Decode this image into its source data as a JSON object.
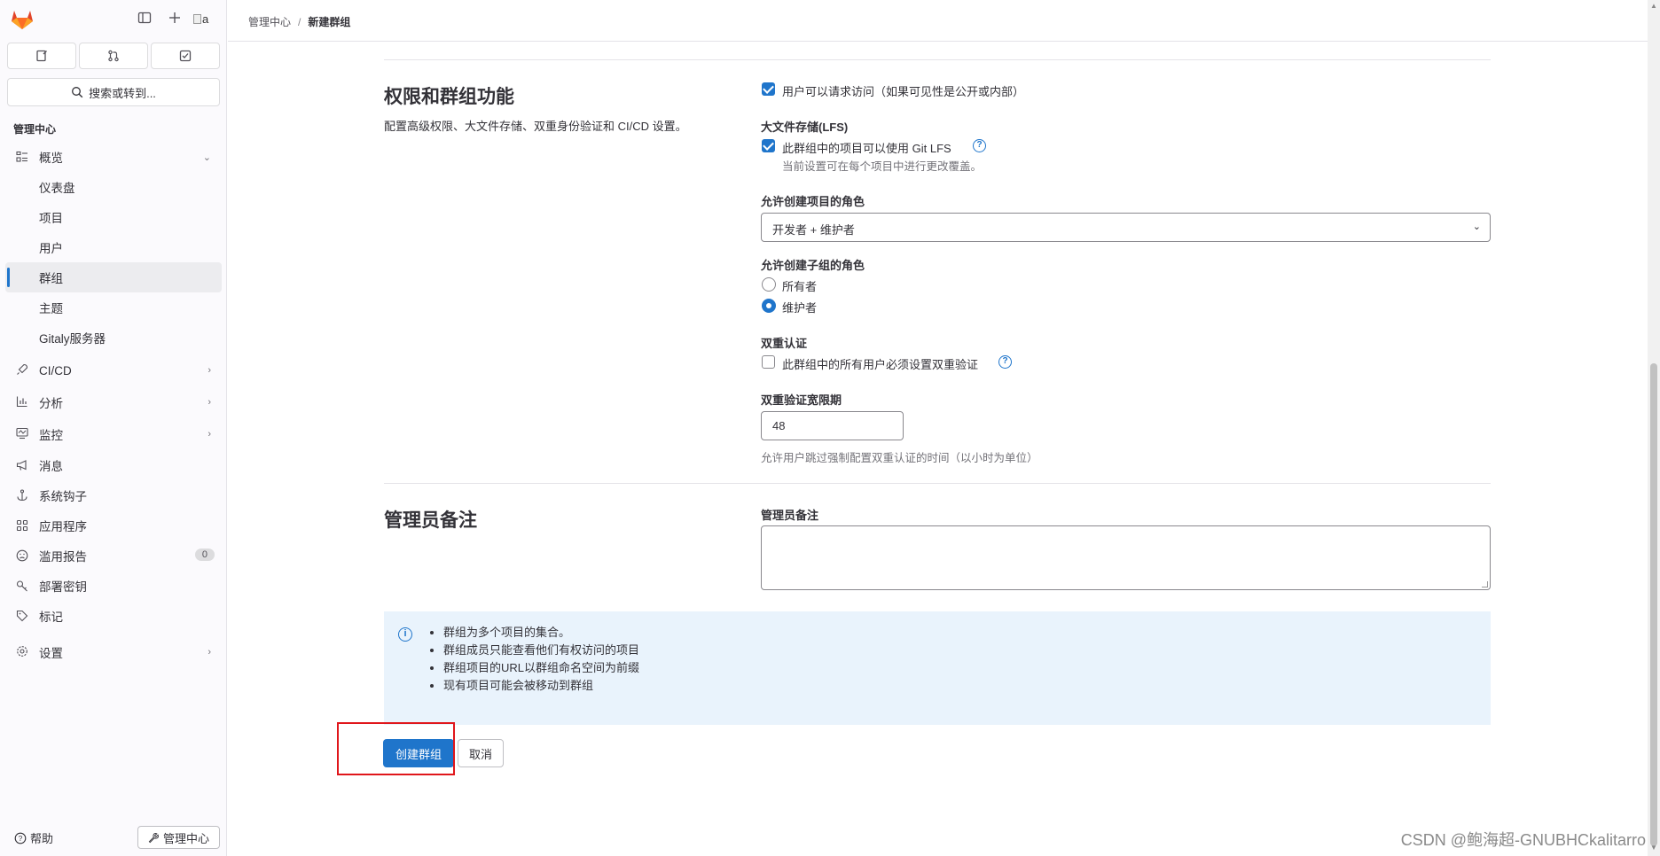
{
  "breadcrumb": {
    "parent": "管理中心",
    "sep": "/",
    "current": "新建群组"
  },
  "search": {
    "placeholder": "搜索或转到..."
  },
  "sidebar": {
    "avatar_alt": "a",
    "section_title": "管理中心",
    "overview": {
      "label": "概览",
      "expanded": true,
      "items": [
        {
          "label": "仪表盘"
        },
        {
          "label": "项目"
        },
        {
          "label": "用户"
        },
        {
          "label": "群组",
          "active": true
        },
        {
          "label": "主题"
        },
        {
          "label": "Gitaly服务器"
        }
      ]
    },
    "items": [
      {
        "label": "CI/CD",
        "icon": "rocket-icon",
        "chevron": true
      },
      {
        "label": "分析",
        "icon": "chart-icon",
        "chevron": true
      },
      {
        "label": "监控",
        "icon": "monitor-icon",
        "chevron": true
      },
      {
        "label": "消息",
        "icon": "bullhorn-icon"
      },
      {
        "label": "系统钩子",
        "icon": "anchor-icon"
      },
      {
        "label": "应用程序",
        "icon": "apps-icon"
      },
      {
        "label": "滥用报告",
        "icon": "abuse-icon",
        "badge": "0"
      },
      {
        "label": "部署密钥",
        "icon": "key-icon"
      },
      {
        "label": "标记",
        "icon": "label-icon"
      },
      {
        "label": "设置",
        "icon": "settings-icon",
        "chevron": true
      }
    ],
    "help": "帮助",
    "admin": "管理中心"
  },
  "permissions": {
    "title": "权限和群组功能",
    "description": "配置高级权限、大文件存储、双重身份验证和 CI/CD 设置。",
    "request_access": {
      "label": "用户可以请求访问（如果可见性是公开或内部）",
      "checked": true
    },
    "lfs": {
      "heading": "大文件存储(LFS)",
      "label": "此群组中的项目可以使用 Git LFS",
      "checked": true,
      "help": "当前设置可在每个项目中进行更改覆盖。"
    },
    "project_creation": {
      "heading": "允许创建项目的角色",
      "selected": "开发者 + 维护者"
    },
    "subgroup_creation": {
      "heading": "允许创建子组的角色",
      "options": [
        {
          "label": "所有者",
          "selected": false
        },
        {
          "label": "维护者",
          "selected": true
        }
      ]
    },
    "two_factor": {
      "heading": "双重认证",
      "label": "此群组中的所有用户必须设置双重验证",
      "checked": false
    },
    "grace_period": {
      "heading": "双重验证宽限期",
      "value": "48",
      "help": "允许用户跳过强制配置双重认证的时间（以小时为单位）"
    }
  },
  "admin_note": {
    "title": "管理员备注",
    "field_label": "管理员备注",
    "value": ""
  },
  "info": {
    "items": [
      "群组为多个项目的集合。",
      "群组成员只能查看他们有权访问的项目",
      "群组项目的URL以群组命名空间为前缀",
      "现有项目可能会被移动到群组"
    ]
  },
  "actions": {
    "create": "创建群组",
    "cancel": "取消"
  },
  "watermark": "CSDN @鲍海超-GNUBHCkalitarro",
  "colors": {
    "primary": "#1f75cb",
    "info_bg": "#e9f3fc",
    "highlight": "#e0161b"
  }
}
